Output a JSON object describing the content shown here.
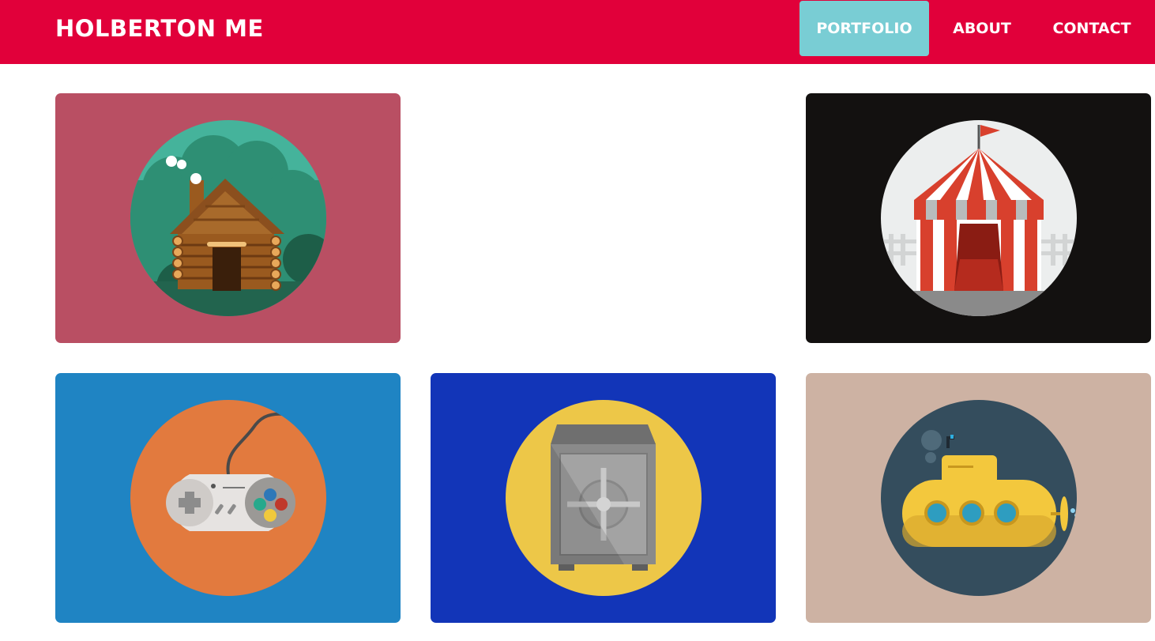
{
  "header": {
    "brand": "HOLBERTON ME",
    "nav": [
      {
        "label": "PORTFOLIO",
        "active": true
      },
      {
        "label": "ABOUT",
        "active": false
      },
      {
        "label": "CONTACT",
        "active": false
      }
    ]
  },
  "colors": {
    "header_bg": "#e1003a",
    "active_nav_bg": "#79cdd4",
    "text_light": "#ffffff"
  },
  "portfolio": {
    "tiles": [
      {
        "icon": "log-cabin-icon",
        "background": "#b94f63",
        "circle": "#45b39b"
      },
      {
        "icon": "circus-tent-icon",
        "background": "#131110",
        "circle": "#eceeee"
      },
      {
        "icon": "game-controller-icon",
        "background": "#1f84c3",
        "circle": "#e27a3e"
      },
      {
        "icon": "safe-icon",
        "background": "#1235b8",
        "circle": "#edc748"
      },
      {
        "icon": "submarine-icon",
        "background": "#cdb2a3",
        "circle": "#344d5d"
      }
    ]
  }
}
